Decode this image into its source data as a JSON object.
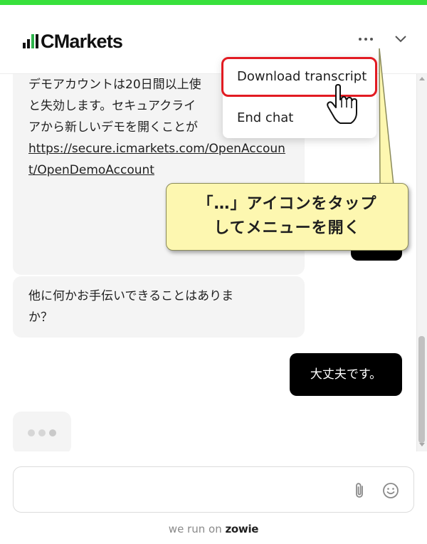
{
  "app": {
    "brand_text": "CMarkets",
    "accent_color": "#38e03c",
    "logo_green": "#2db44a"
  },
  "header": {
    "more_icon": "ellipsis-icon",
    "collapse_icon": "chevron-down-icon"
  },
  "menu": {
    "items": [
      {
        "label": "Download transcript"
      },
      {
        "label": "End chat"
      }
    ],
    "highlight_color": "#e21b22"
  },
  "messages": [
    {
      "sender": "bot",
      "text": "デモアカウントは20日間以上使\nと失効します。セキュアクライ\nアから新しいデモを開くことが",
      "link": "https://secure.icmarkets.com/OpenAccount/OpenDemoAccount"
    },
    {
      "sender": "bot",
      "lines": [
        "他に何かお手伝いできることはありま",
        "か？"
      ]
    },
    {
      "sender": "user",
      "text": "大丈夫です。"
    }
  ],
  "composer": {
    "placeholder": "",
    "attach_icon": "paperclip-icon",
    "emoji_icon": "smiley-icon"
  },
  "footer": {
    "prefix": "we run on ",
    "brand": "zowie"
  },
  "callout": {
    "line1": "「…」アイコンをタップ",
    "line2": "してメニューを開く",
    "bg_color": "#fdf7b0"
  }
}
